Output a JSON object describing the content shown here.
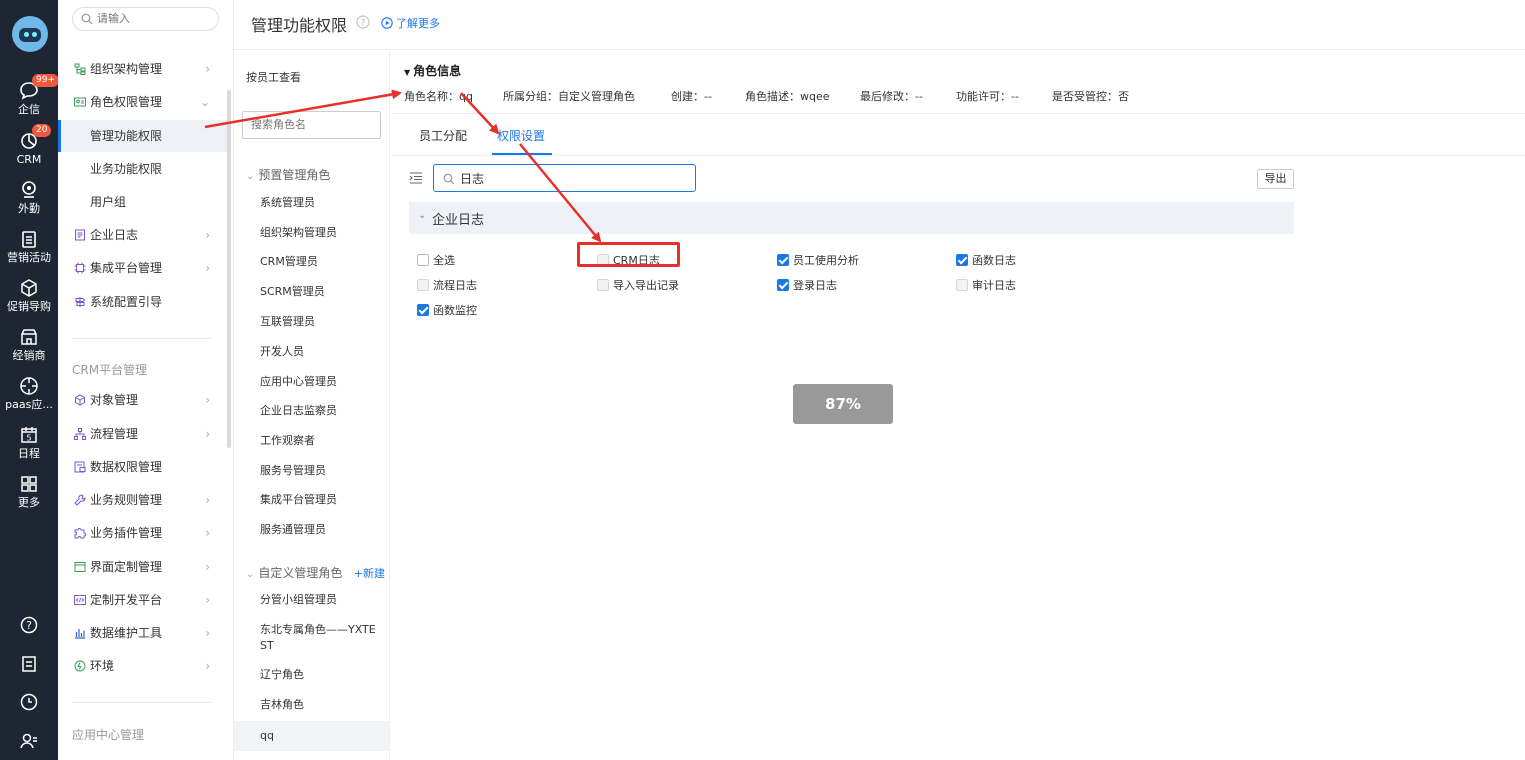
{
  "rail": {
    "items": [
      {
        "icon": "chat-icon",
        "label": "企信",
        "badge": "99+"
      },
      {
        "icon": "crm-icon",
        "label": "CRM",
        "badge": "20"
      },
      {
        "icon": "location-icon",
        "label": "外勤"
      },
      {
        "icon": "clipboard-icon",
        "label": "营销活动"
      },
      {
        "icon": "box-icon",
        "label": "促销导购"
      },
      {
        "icon": "store-icon",
        "label": "经销商"
      },
      {
        "icon": "target-icon",
        "label": "paas应..."
      },
      {
        "icon": "calendar-icon",
        "label": "日程",
        "day": "5"
      },
      {
        "icon": "grid-icon",
        "label": "更多"
      }
    ]
  },
  "sidebar": {
    "search_placeholder": "请输入",
    "items": [
      {
        "label": "组织架构管理"
      },
      {
        "label": "角色权限管理"
      },
      {
        "label": "管理功能权限"
      },
      {
        "label": "业务功能权限"
      },
      {
        "label": "用户组"
      },
      {
        "label": "企业日志"
      },
      {
        "label": "集成平台管理"
      },
      {
        "label": "系统配置引导"
      }
    ],
    "group2": "CRM平台管理",
    "items2": [
      {
        "label": "对象管理"
      },
      {
        "label": "流程管理"
      },
      {
        "label": "数据权限管理"
      },
      {
        "label": "业务规则管理"
      },
      {
        "label": "业务插件管理"
      },
      {
        "label": "界面定制管理"
      },
      {
        "label": "定制开发平台"
      },
      {
        "label": "数据维护工具"
      },
      {
        "label": "环境"
      }
    ],
    "group3": "应用中心管理"
  },
  "header": {
    "title": "管理功能权限",
    "learn_more": "了解更多"
  },
  "roles": {
    "by_employee": "按员工查看",
    "search_placeholder": "搜索角色名",
    "preset_group": "预置管理角色",
    "preset": [
      "系统管理员",
      "组织架构管理员",
      "CRM管理员",
      "SCRM管理员",
      "互联管理员",
      "开发人员",
      "应用中心管理员",
      "企业日志监察员",
      "工作观察者",
      "服务号管理员",
      "集成平台管理员",
      "服务通管理员"
    ],
    "custom_group": "自定义管理角色",
    "new_label": "+新建",
    "custom": [
      "分管小组管理员",
      "东北专属角色——YXTEST",
      "辽宁角色",
      "吉林角色",
      "qq"
    ]
  },
  "role_info": {
    "title": "角色信息",
    "name": "角色名称：qq",
    "group": "所属分组：自定义管理角色",
    "created": "创建：--",
    "desc": "角色描述：wqee",
    "modified": "最后修改：--",
    "license": "功能许可：--",
    "controlled": "是否受管控：否"
  },
  "tabs": {
    "employee": "员工分配",
    "permission": "权限设置"
  },
  "perm": {
    "search_value": "日志",
    "export_label": "导出",
    "section": "企业日志",
    "items": {
      "all": "全选",
      "crm_log": "CRM日志",
      "emp_analysis": "员工使用分析",
      "func_log": "函数日志",
      "flow_log": "流程日志",
      "import_export": "导入导出记录",
      "login_log": "登录日志",
      "audit_log": "审计日志",
      "func_monitor": "函数监控"
    }
  },
  "progress": "87%"
}
